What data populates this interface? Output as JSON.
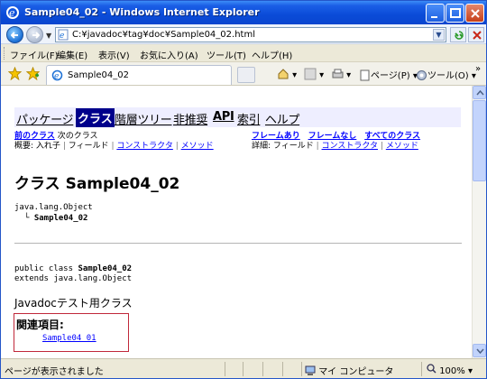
{
  "window": {
    "title": "Sample04_02 - Windows Internet Explorer"
  },
  "address_bar": {
    "url": "C:¥javadoc¥tag¥doc¥Sample04_02.html"
  },
  "menu": {
    "items": [
      "ファイル(F)",
      "編集(E)",
      "表示(V)",
      "お気に入り(A)",
      "ツール(T)",
      "ヘルプ(H)"
    ]
  },
  "tab": {
    "label": "Sample04_02"
  },
  "command_bar": {
    "page_label": "ページ(P)",
    "tools_label": "ツール(O)",
    "overflow": "»"
  },
  "javadoc": {
    "nav": {
      "package": "パッケージ",
      "class": "クラス",
      "tree": "階層ツリー",
      "deprecated": "非推奨",
      "api": "API",
      "index": "索引",
      "help": "ヘルプ"
    },
    "prev_class": "前のクラス",
    "next_class": "次のクラス",
    "frames": "フレームあり",
    "no_frames": "フレームなし",
    "all_classes": "すべてのクラス",
    "summary_label": "概要:",
    "summary_nested": "入れ子",
    "summary_field": "フィールド",
    "summary_constructor": "コンストラクタ",
    "summary_method": "メソッド",
    "detail_label": "詳細:",
    "detail_field": "フィールド",
    "detail_constructor": "コンストラクタ",
    "detail_method": "メソッド",
    "separator": "|",
    "class_title": "クラス Sample04_02",
    "hierarchy_root": "java.lang.Object",
    "hierarchy_child": "Sample04_02",
    "declaration_prefix": "public class",
    "declaration_name": "Sample04_02",
    "declaration_extends": "extends java.lang.Object",
    "description": "Javadocテスト用クラス",
    "see_also_label": "関連項目:",
    "see_also_link": "Sample04_01"
  },
  "status_bar": {
    "text": "ページが表示されました",
    "zone": "マイ コンピュータ",
    "zoom": "100%"
  },
  "colors": {
    "titlebar": "#0a4bd8",
    "nav_background": "#eeeeff",
    "nav_current": "#00008b",
    "link": "#0000ff",
    "see_also_border": "#c0283a"
  }
}
